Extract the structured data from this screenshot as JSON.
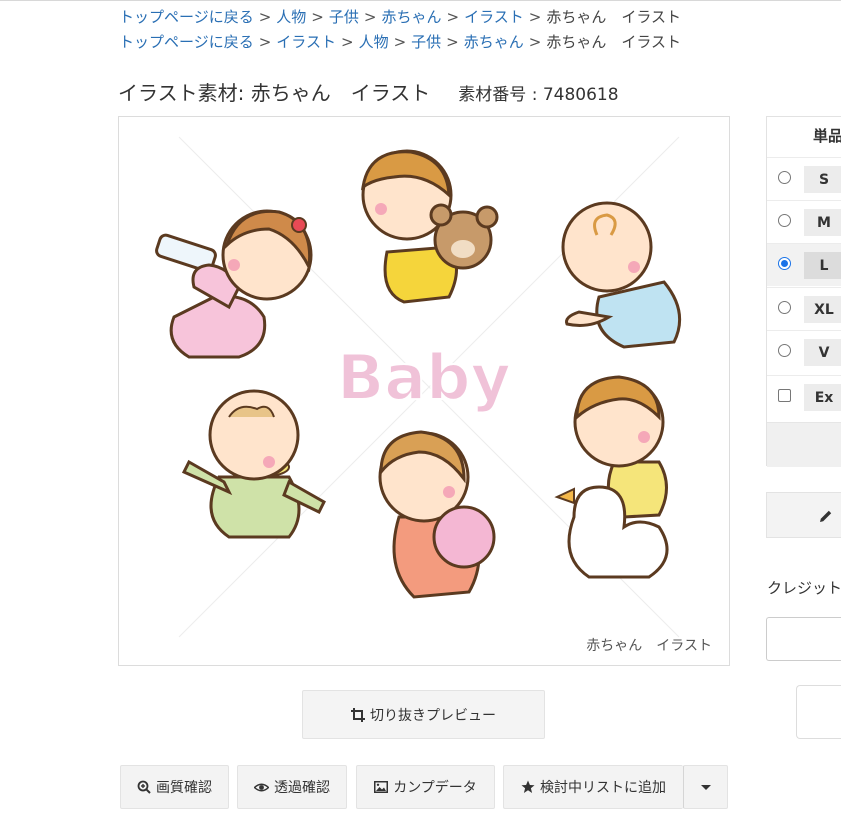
{
  "breadcrumbs": [
    {
      "links": [
        "トップページに戻る",
        "人物",
        "子供",
        "赤ちゃん",
        "イラスト"
      ],
      "current": "赤ちゃん　イラスト"
    },
    {
      "links": [
        "トップページに戻る",
        "イラスト",
        "人物",
        "子供",
        "赤ちゃん"
      ],
      "current": "赤ちゃん　イラスト"
    }
  ],
  "separator": ">",
  "header": {
    "title": "イラスト素材: 赤ちゃん　イラスト",
    "material_number": "素材番号 : 7480618"
  },
  "image": {
    "logo_text": "Baby",
    "caption": "赤ちゃん　イラスト"
  },
  "buttons": {
    "crop_preview": "切り抜きプレビュー",
    "quality_check": "画質確認",
    "transparency_check": "透過確認",
    "comp_data": "カンプデータ",
    "add_to_list": "検討中リストに追加"
  },
  "purchase_panel": {
    "heading": "単品",
    "sizes": [
      {
        "label": "S",
        "selected": false,
        "type": "radio"
      },
      {
        "label": "M",
        "selected": false,
        "type": "radio"
      },
      {
        "label": "L",
        "selected": true,
        "type": "radio"
      },
      {
        "label": "XL",
        "selected": false,
        "type": "radio"
      },
      {
        "label": "V",
        "selected": false,
        "type": "radio"
      },
      {
        "label": "Ex",
        "selected": false,
        "type": "checkbox"
      }
    ]
  },
  "credit_label": "クレジット",
  "colors": {
    "link": "#2a6fb4",
    "radio_selected": "#1a73e8",
    "button_bg": "#f3f3f3"
  },
  "icons": [
    "crop-icon",
    "zoom-in-icon",
    "eye-icon",
    "image-icon",
    "star-icon",
    "caret-down-icon",
    "pencil-icon"
  ]
}
